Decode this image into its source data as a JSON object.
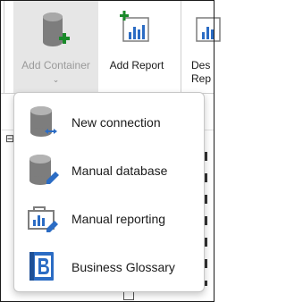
{
  "ribbon": {
    "add_container_label": "Add Container",
    "add_container_chevron": "⌄",
    "add_report_label": "Add Report",
    "desc_line1": "Des",
    "desc_line2": "Rep"
  },
  "menu": {
    "items": [
      {
        "label": "New connection",
        "icon": "database-connection-icon"
      },
      {
        "label": "Manual database",
        "icon": "database-edit-icon"
      },
      {
        "label": "Manual reporting",
        "icon": "report-edit-icon"
      },
      {
        "label": "Business Glossary",
        "icon": "business-glossary-icon"
      }
    ]
  },
  "colors": {
    "accent_green": "#1a8a2a",
    "icon_gray": "#7d7d7d",
    "accent_blue": "#2b6cc4"
  }
}
